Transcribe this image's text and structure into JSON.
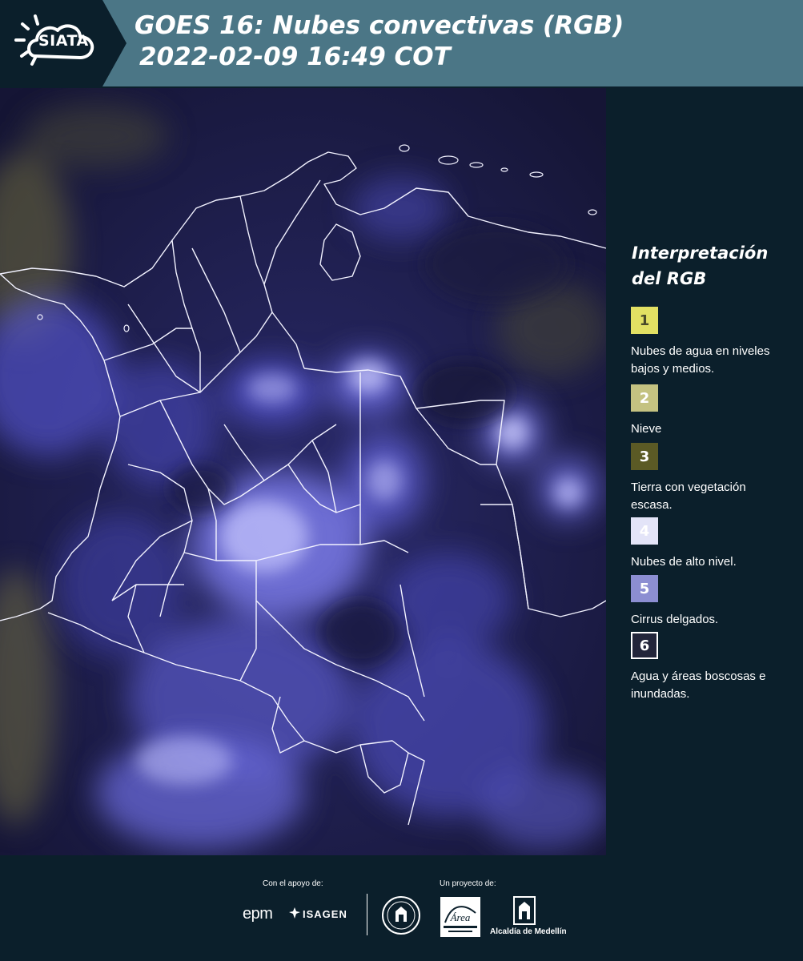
{
  "header": {
    "logo_text": "SIATA",
    "title_line1": "GOES 16: Nubes convectivas (RGB)",
    "title_line2": "2022-02-09 16:49 COT"
  },
  "map": {
    "icon": "satellite-image"
  },
  "legend": {
    "title": "Interpretación del RGB",
    "items": [
      {
        "number": "1",
        "label": "Nubes de agua en niveles bajos y medios.",
        "color": "#e2e063",
        "text_color": "#4a4a2a"
      },
      {
        "number": "2",
        "label": "Nieve",
        "color": "#c4c281",
        "text_color": "#ffffff"
      },
      {
        "number": "3",
        "label": "Tierra con vegetación escasa.",
        "color": "#5b5a25",
        "text_color": "#ffffff"
      },
      {
        "number": "4",
        "label": "Nubes de alto nivel.",
        "color": "#e3e4f8",
        "text_color": "#ffffff"
      },
      {
        "number": "5",
        "label": "Cirrus delgados.",
        "color": "#8c8ed2",
        "text_color": "#ffffff"
      },
      {
        "number": "6",
        "label": "Agua y áreas boscosas e inundadas.",
        "color": "#22253a",
        "text_color": "#ffffff"
      }
    ]
  },
  "footer": {
    "support_label": "Con el apoyo de:",
    "project_label": "Un proyecto de:",
    "epm": "epm",
    "isagen": "ISAGEN",
    "alcaldia": "Alcaldía de Medellín",
    "area_logo": "Área Metropolitana Valle de Aburrá"
  }
}
